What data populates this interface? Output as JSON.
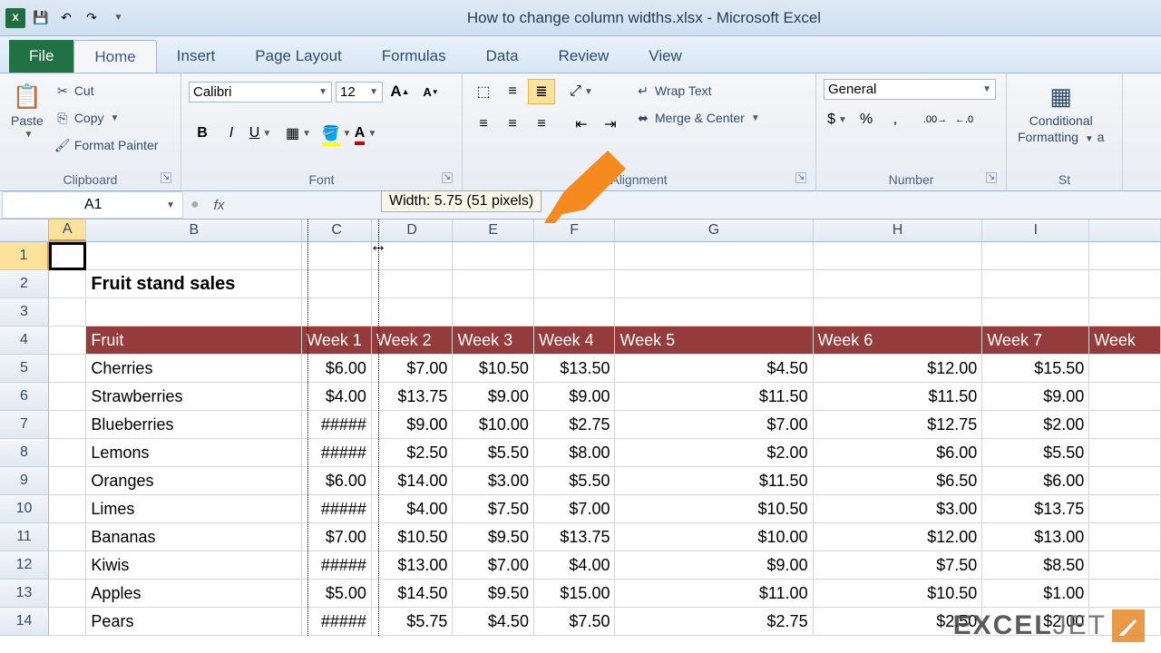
{
  "title": "How to change column widths.xlsx - Microsoft Excel",
  "qat": {
    "save": "💾",
    "undo": "↶",
    "redo": "↷"
  },
  "tabs": [
    "File",
    "Home",
    "Insert",
    "Page Layout",
    "Formulas",
    "Data",
    "Review",
    "View"
  ],
  "active_tab": 1,
  "clipboard": {
    "paste": "Paste",
    "cut": "Cut",
    "copy": "Copy",
    "fp": "Format Painter",
    "label": "Clipboard"
  },
  "font": {
    "name": "Calibri",
    "size": "12",
    "label": "Font"
  },
  "alignment": {
    "wrap": "Wrap Text",
    "merge": "Merge & Center",
    "label": "Alignment"
  },
  "number": {
    "format": "General",
    "label": "Number"
  },
  "styles": {
    "cf": "Conditional",
    "cf2": "Formatting",
    "label": "St"
  },
  "namebox": "A1",
  "width_tip": "Width: 5.75 (51 pixels)",
  "columns": [
    "A",
    "B",
    "C",
    "D",
    "E",
    "F",
    "G",
    "H",
    "I",
    ""
  ],
  "sheet_title": "Fruit stand sales",
  "table": {
    "headers": [
      "Fruit",
      "Week 1",
      "Week 2",
      "Week 3",
      "Week 4",
      "Week 5",
      "Week 6",
      "Week 7",
      "Week"
    ],
    "rows": [
      [
        "Cherries",
        "$6.00",
        "$7.00",
        "$10.50",
        "$13.50",
        "$4.50",
        "$12.00",
        "$15.50",
        ""
      ],
      [
        "Strawberries",
        "$4.00",
        "$13.75",
        "$9.00",
        "$9.00",
        "$11.50",
        "$11.50",
        "$9.00",
        ""
      ],
      [
        "Blueberries",
        "#####",
        "$9.00",
        "$10.00",
        "$2.75",
        "$7.00",
        "$12.75",
        "$2.00",
        ""
      ],
      [
        "Lemons",
        "#####",
        "$2.50",
        "$5.50",
        "$8.00",
        "$2.00",
        "$6.00",
        "$5.50",
        ""
      ],
      [
        "Oranges",
        "$6.00",
        "$14.00",
        "$3.00",
        "$5.50",
        "$11.50",
        "$6.50",
        "$6.00",
        ""
      ],
      [
        "Limes",
        "#####",
        "$4.00",
        "$7.50",
        "$7.00",
        "$10.50",
        "$3.00",
        "$13.75",
        ""
      ],
      [
        "Bananas",
        "$7.00",
        "$10.50",
        "$9.50",
        "$13.75",
        "$10.00",
        "$12.00",
        "$13.00",
        ""
      ],
      [
        "Kiwis",
        "#####",
        "$13.00",
        "$7.00",
        "$4.00",
        "$9.00",
        "$7.50",
        "$8.50",
        ""
      ],
      [
        "Apples",
        "$5.00",
        "$14.50",
        "$9.50",
        "$15.00",
        "$11.00",
        "$10.50",
        "$1.00",
        ""
      ],
      [
        "Pears",
        "#####",
        "$5.75",
        "$4.50",
        "$7.50",
        "$2.75",
        "$2.50",
        "$2.00",
        ""
      ]
    ]
  },
  "watermark": "EXCELJET"
}
